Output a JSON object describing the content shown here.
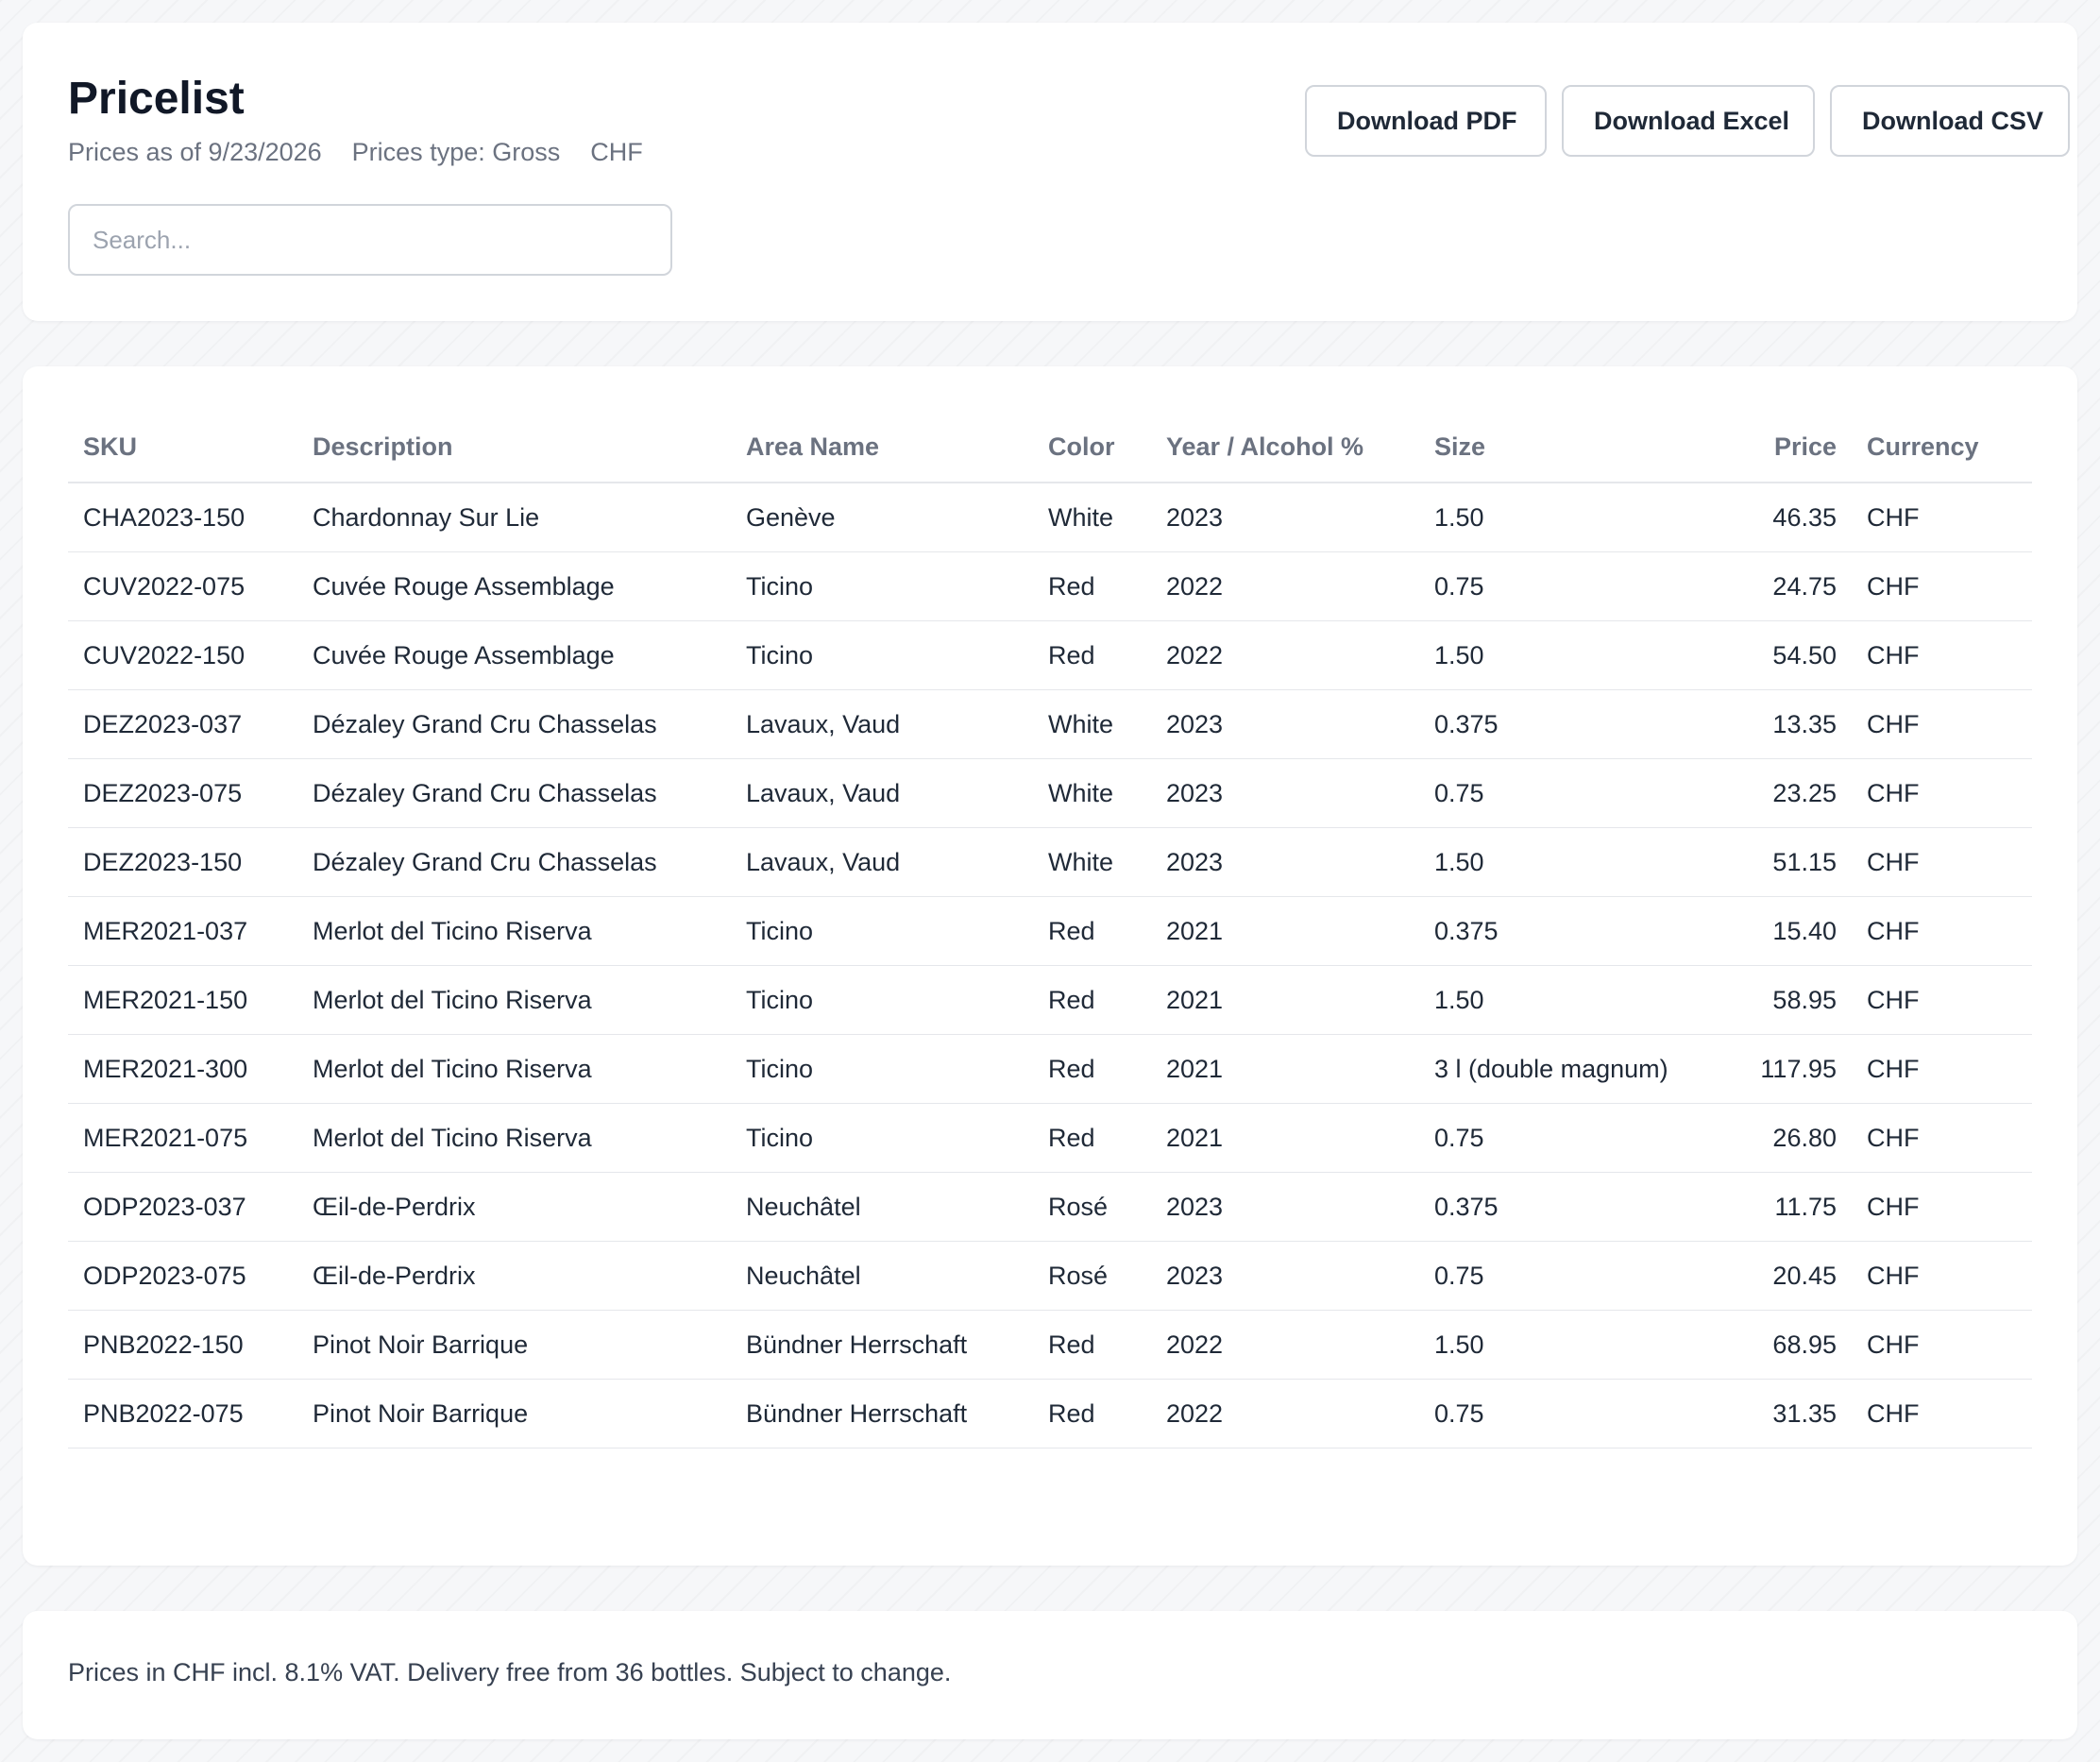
{
  "header": {
    "title": "Pricelist",
    "prices_as_of": "Prices as of 9/23/2026",
    "prices_type": "Prices type: Gross",
    "currency": "CHF"
  },
  "search": {
    "placeholder": "Search..."
  },
  "actions": {
    "download_pdf": "Download PDF",
    "download_excel": "Download Excel",
    "download_csv": "Download CSV"
  },
  "table": {
    "columns": {
      "sku": "SKU",
      "description": "Description",
      "area": "Area Name",
      "color": "Color",
      "year": "Year / Alcohol %",
      "size": "Size",
      "price": "Price",
      "currency": "Currency"
    },
    "rows": [
      {
        "sku": "CHA2023-150",
        "description": "Chardonnay Sur Lie",
        "area": "Genève",
        "color": "White",
        "year": "2023",
        "size": "1.50",
        "price": "46.35",
        "currency": "CHF"
      },
      {
        "sku": "CUV2022-075",
        "description": "Cuvée Rouge Assemblage",
        "area": "Ticino",
        "color": "Red",
        "year": "2022",
        "size": "0.75",
        "price": "24.75",
        "currency": "CHF"
      },
      {
        "sku": "CUV2022-150",
        "description": "Cuvée Rouge Assemblage",
        "area": "Ticino",
        "color": "Red",
        "year": "2022",
        "size": "1.50",
        "price": "54.50",
        "currency": "CHF"
      },
      {
        "sku": "DEZ2023-037",
        "description": "Dézaley Grand Cru Chasselas",
        "area": "Lavaux, Vaud",
        "color": "White",
        "year": "2023",
        "size": "0.375",
        "price": "13.35",
        "currency": "CHF"
      },
      {
        "sku": "DEZ2023-075",
        "description": "Dézaley Grand Cru Chasselas",
        "area": "Lavaux, Vaud",
        "color": "White",
        "year": "2023",
        "size": "0.75",
        "price": "23.25",
        "currency": "CHF"
      },
      {
        "sku": "DEZ2023-150",
        "description": "Dézaley Grand Cru Chasselas",
        "area": "Lavaux, Vaud",
        "color": "White",
        "year": "2023",
        "size": "1.50",
        "price": "51.15",
        "currency": "CHF"
      },
      {
        "sku": "MER2021-037",
        "description": "Merlot del Ticino Riserva",
        "area": "Ticino",
        "color": "Red",
        "year": "2021",
        "size": "0.375",
        "price": "15.40",
        "currency": "CHF"
      },
      {
        "sku": "MER2021-150",
        "description": "Merlot del Ticino Riserva",
        "area": "Ticino",
        "color": "Red",
        "year": "2021",
        "size": "1.50",
        "price": "58.95",
        "currency": "CHF"
      },
      {
        "sku": "MER2021-300",
        "description": "Merlot del Ticino Riserva",
        "area": "Ticino",
        "color": "Red",
        "year": "2021",
        "size": "3 l (double magnum)",
        "price": "117.95",
        "currency": "CHF"
      },
      {
        "sku": "MER2021-075",
        "description": "Merlot del Ticino Riserva",
        "area": "Ticino",
        "color": "Red",
        "year": "2021",
        "size": "0.75",
        "price": "26.80",
        "currency": "CHF"
      },
      {
        "sku": "ODP2023-037",
        "description": "Œil-de-Perdrix",
        "area": "Neuchâtel",
        "color": "Rosé",
        "year": "2023",
        "size": "0.375",
        "price": "11.75",
        "currency": "CHF"
      },
      {
        "sku": "ODP2023-075",
        "description": "Œil-de-Perdrix",
        "area": "Neuchâtel",
        "color": "Rosé",
        "year": "2023",
        "size": "0.75",
        "price": "20.45",
        "currency": "CHF"
      },
      {
        "sku": "PNB2022-150",
        "description": "Pinot Noir Barrique",
        "area": "Bündner Herrschaft",
        "color": "Red",
        "year": "2022",
        "size": "1.50",
        "price": "68.95",
        "currency": "CHF"
      },
      {
        "sku": "PNB2022-075",
        "description": "Pinot Noir Barrique",
        "area": "Bündner Herrschaft",
        "color": "Red",
        "year": "2022",
        "size": "0.75",
        "price": "31.35",
        "currency": "CHF"
      }
    ]
  },
  "footer": {
    "note": "Prices in CHF incl. 8.1% VAT. Delivery free from 36 bottles. Subject to change."
  }
}
